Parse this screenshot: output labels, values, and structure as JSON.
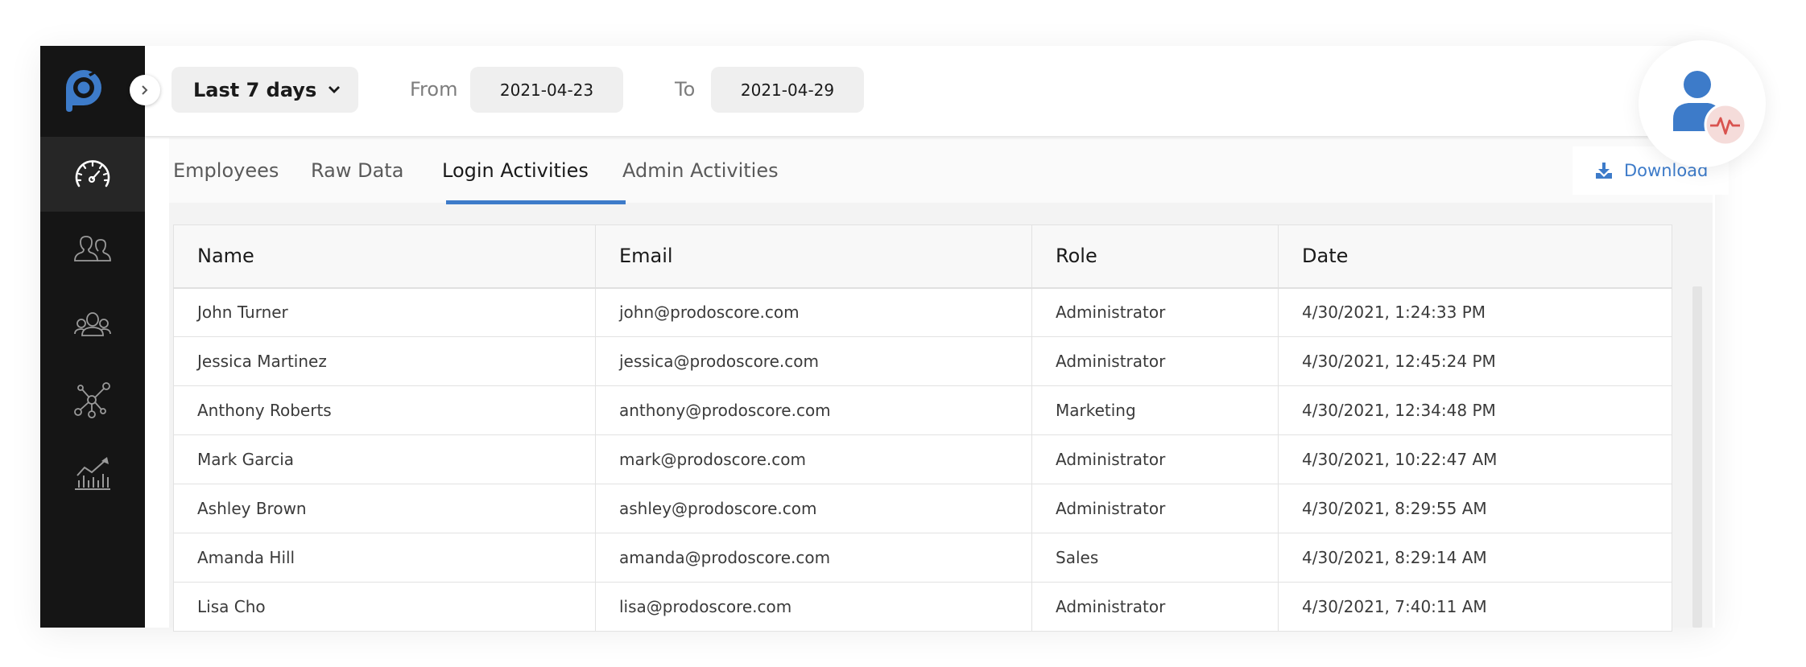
{
  "app": {
    "brand_color": "#3d7bc9",
    "sidebar_color": "#151515",
    "alert_color": "#d9534f"
  },
  "sidebar": {
    "logo": "prodoscore-logo",
    "expand_icon": "chevron-right-icon",
    "items": [
      {
        "id": "dashboard",
        "icon": "speedometer-icon",
        "active": true
      },
      {
        "id": "users",
        "icon": "users-icon",
        "active": false
      },
      {
        "id": "teams",
        "icon": "team-group-icon",
        "active": false
      },
      {
        "id": "network",
        "icon": "network-hub-icon",
        "active": false
      },
      {
        "id": "analytics",
        "icon": "chart-trend-icon",
        "active": false
      }
    ]
  },
  "header": {
    "range_select": {
      "value": "Last 7 days",
      "icon": "chevron-down-icon"
    },
    "from_label": "From",
    "from_value": "2021-04-23",
    "to_label": "To",
    "to_value": "2021-04-29"
  },
  "tabs": [
    {
      "label": "Employees",
      "active": false
    },
    {
      "label": "Raw Data",
      "active": false
    },
    {
      "label": "Login Activities",
      "active": true
    },
    {
      "label": "Admin Activities",
      "active": false
    }
  ],
  "download": {
    "label": "Download",
    "icon": "download-icon"
  },
  "user_avatar": {
    "icon": "user-activity-icon"
  },
  "table": {
    "columns": [
      "Name",
      "Email",
      "Role",
      "Date"
    ],
    "rows": [
      {
        "name": "John Turner",
        "email": "john@prodoscore.com",
        "role": "Administrator",
        "date": "4/30/2021, 1:24:33 PM"
      },
      {
        "name": "Jessica Martinez",
        "email": "jessica@prodoscore.com",
        "role": "Administrator",
        "date": "4/30/2021, 12:45:24 PM"
      },
      {
        "name": "Anthony Roberts",
        "email": "anthony@prodoscore.com",
        "role": "Marketing",
        "date": "4/30/2021, 12:34:48 PM"
      },
      {
        "name": "Mark Garcia",
        "email": "mark@prodoscore.com",
        "role": "Administrator",
        "date": "4/30/2021, 10:22:47 AM"
      },
      {
        "name": "Ashley Brown",
        "email": "ashley@prodoscore.com",
        "role": "Administrator",
        "date": "4/30/2021, 8:29:55 AM"
      },
      {
        "name": "Amanda Hill",
        "email": "amanda@prodoscore.com",
        "role": "Sales",
        "date": "4/30/2021, 8:29:14 AM"
      },
      {
        "name": "Lisa Cho",
        "email": "lisa@prodoscore.com",
        "role": "Administrator",
        "date": "4/30/2021, 7:40:11 AM"
      }
    ]
  }
}
